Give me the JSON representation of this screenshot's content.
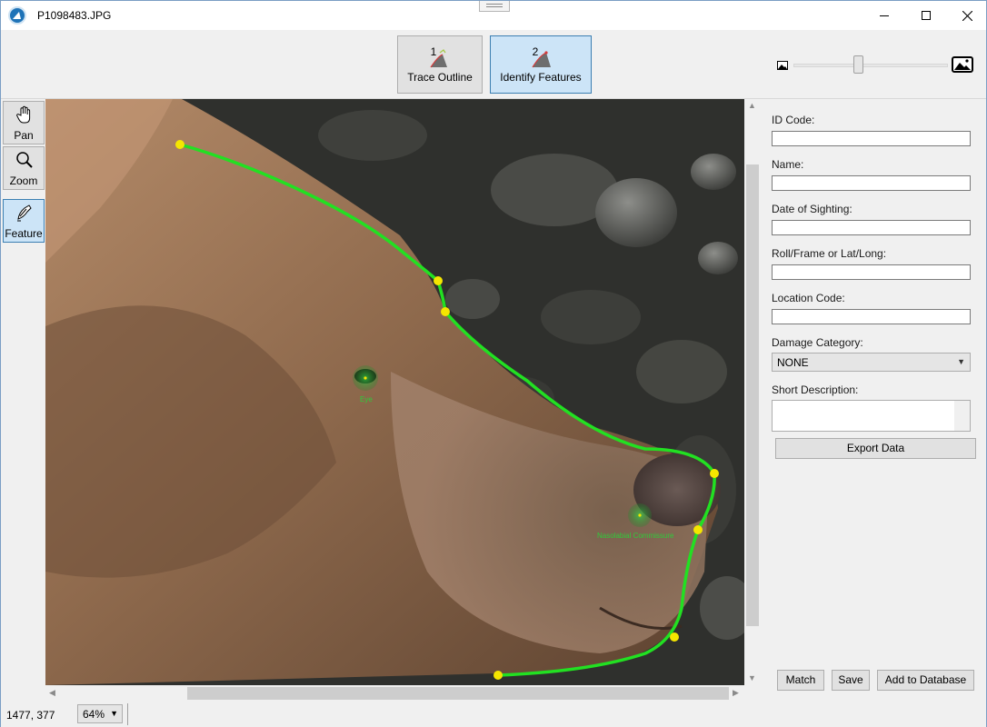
{
  "window": {
    "title": "P1098483.JPG"
  },
  "toolbar": {
    "steps": [
      {
        "number": "1",
        "label": "Trace Outline"
      },
      {
        "number": "2",
        "label": "Identify Features"
      }
    ],
    "zoom_slider": {
      "value_fraction": 0.42
    }
  },
  "tools": [
    {
      "label": "Pan",
      "icon": "hand-icon"
    },
    {
      "label": "Zoom",
      "icon": "magnifier-icon"
    },
    {
      "label": "Feature",
      "icon": "feature-pen-icon"
    }
  ],
  "canvas": {
    "features": [
      {
        "label": "Eye"
      },
      {
        "label": "Nasolabial Commissure"
      }
    ],
    "outline_color": "#22e022",
    "control_point_color": "#f5e600"
  },
  "form": {
    "id_code": {
      "label": "ID Code:",
      "value": ""
    },
    "name": {
      "label": "Name:",
      "value": ""
    },
    "date": {
      "label": "Date of Sighting:",
      "value": ""
    },
    "roll": {
      "label": "Roll/Frame or Lat/Long:",
      "value": ""
    },
    "location": {
      "label": "Location Code:",
      "value": ""
    },
    "damage": {
      "label": "Damage Category:",
      "value": "NONE"
    },
    "description": {
      "label": "Short Description:",
      "value": ""
    },
    "export_label": "Export Data",
    "match_label": "Match",
    "save_label": "Save",
    "add_label": "Add to Database"
  },
  "status": {
    "coords": "1477, 377",
    "zoom": "64%"
  }
}
